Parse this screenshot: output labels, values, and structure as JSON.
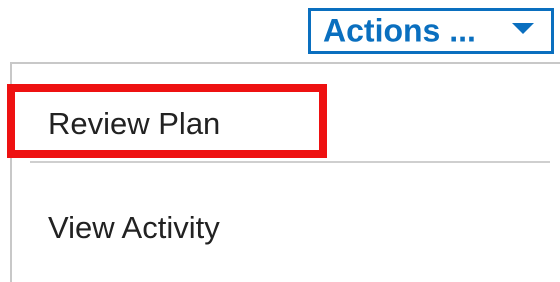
{
  "actions_button": {
    "label": "Actions ...",
    "caret_icon": "caret-down-icon",
    "color": "#0a6fbf"
  },
  "menu": {
    "items": [
      {
        "label": "Review Plan",
        "highlighted": true
      },
      {
        "label": "View Activity",
        "highlighted": false
      }
    ]
  },
  "highlight": {
    "color": "#ee1111"
  }
}
